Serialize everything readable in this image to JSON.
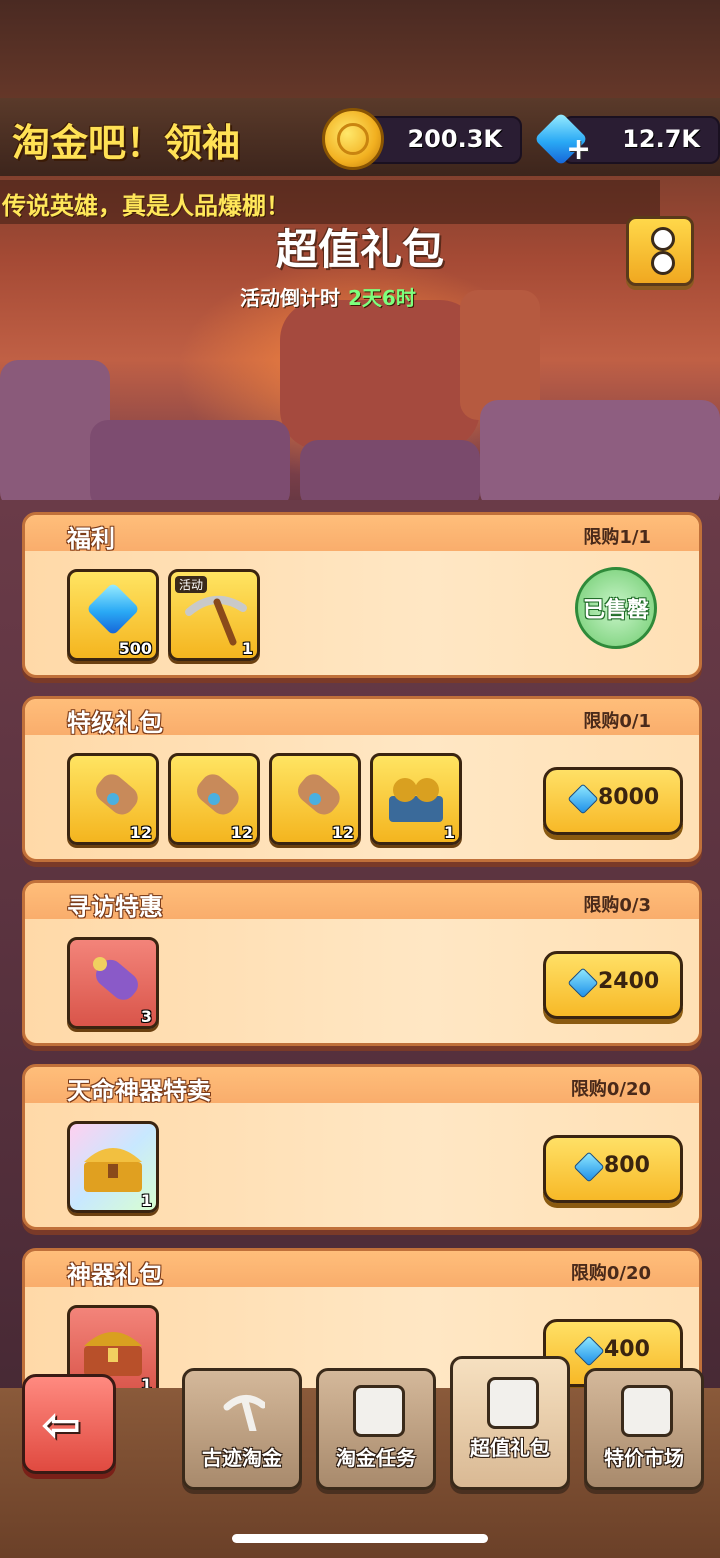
{
  "header": {
    "title": "淘金吧！领袖",
    "gold_amount": "200.3K",
    "gem_amount": "12.7K"
  },
  "marquee": "传说英雄，真是人品爆棚！",
  "page": {
    "title": "超值礼包",
    "countdown_label": "活动倒计时",
    "countdown_value": "2天6时"
  },
  "packs": [
    {
      "name": "福利",
      "limit": "限购1/1",
      "items": [
        {
          "icon": "gem-icon",
          "qty": "500"
        },
        {
          "icon": "pickaxe-icon",
          "qty": "1",
          "tag": "活动"
        }
      ],
      "status": "已售罄"
    },
    {
      "name": "特级礼包",
      "limit": "限购0/1",
      "items": [
        {
          "icon": "scroll-icon",
          "qty": "12"
        },
        {
          "icon": "scroll-icon",
          "qty": "12"
        },
        {
          "icon": "scroll-icon",
          "qty": "12"
        },
        {
          "icon": "mask-chest-icon",
          "qty": "1"
        }
      ],
      "price": "8000"
    },
    {
      "name": "寻访特惠",
      "limit": "限购0/3",
      "items": [
        {
          "icon": "purple-scroll-icon",
          "qty": "3"
        }
      ],
      "price": "2400"
    },
    {
      "name": "天命神器特卖",
      "limit": "限购0/20",
      "items": [
        {
          "icon": "golden-chest-icon",
          "qty": "1"
        }
      ],
      "price": "800"
    },
    {
      "name": "神器礼包",
      "limit": "限购0/20",
      "items": [
        {
          "icon": "treasure-chest-icon",
          "qty": "1"
        }
      ],
      "price": "400"
    }
  ],
  "nav": {
    "tabs": [
      {
        "label": "古迹淘金",
        "icon": "pickaxe-icon"
      },
      {
        "label": "淘金任务",
        "icon": "clipboard-icon"
      },
      {
        "label": "超值礼包",
        "icon": "gift-box-icon"
      },
      {
        "label": "特价市场",
        "icon": "shop-icon"
      }
    ]
  },
  "colors": {
    "accent_yellow": "#ffe155",
    "countdown_green": "#7dff7d",
    "card_bg": "#ffc98a"
  }
}
